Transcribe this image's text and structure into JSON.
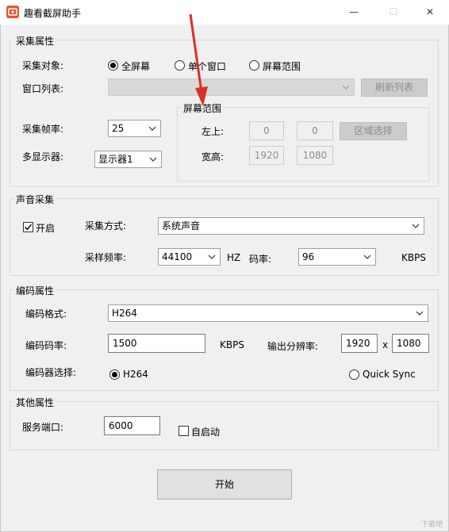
{
  "window": {
    "title": "趣看截屏助手",
    "controls": {
      "minimize": "—",
      "maximize": "☐",
      "close": "✕"
    }
  },
  "capture": {
    "legend": "采集属性",
    "target_label": "采集对象:",
    "target_options": [
      "全屏幕",
      "单个窗口",
      "屏幕范围"
    ],
    "target_selected": "全屏幕",
    "window_list_label": "窗口列表:",
    "window_list_value": "",
    "refresh_label": "刷新列表",
    "fps_label": "采集帧率:",
    "fps_value": "25",
    "monitor_label": "多显示器:",
    "monitor_value": "显示器1",
    "range": {
      "legend": "屏幕范围",
      "topleft_label": "左上:",
      "x": "0",
      "y": "0",
      "select_label": "区域选择",
      "size_label": "宽高:",
      "w": "1920",
      "h": "1080"
    }
  },
  "audio": {
    "legend": "声音采集",
    "enable_label": "开启",
    "enabled": true,
    "mode_label": "采集方式:",
    "mode_value": "系统声音",
    "rate_label": "采样频率:",
    "rate_value": "44100",
    "rate_unit": "HZ",
    "bitrate_label": "码率:",
    "bitrate_value": "96",
    "bitrate_unit": "KBPS"
  },
  "encode": {
    "legend": "编码属性",
    "format_label": "编码格式:",
    "format_value": "H264",
    "bitrate_label": "编码码率:",
    "bitrate_value": "1500",
    "bitrate_unit": "KBPS",
    "resolution_label": "输出分辨率:",
    "res_w": "1920",
    "res_x": "x",
    "res_h": "1080",
    "encoder_label": "编码器选择:",
    "encoder_options": [
      "H264",
      "Quick Sync"
    ],
    "encoder_selected": "H264"
  },
  "other": {
    "legend": "其他属性",
    "port_label": "服务端口:",
    "port_value": "6000",
    "autostart_label": "自启动",
    "autostart": false
  },
  "start_label": "开始",
  "watermark": "下载吧",
  "colors": {
    "arrow": "#d9302a",
    "icon": "#e8542a"
  }
}
